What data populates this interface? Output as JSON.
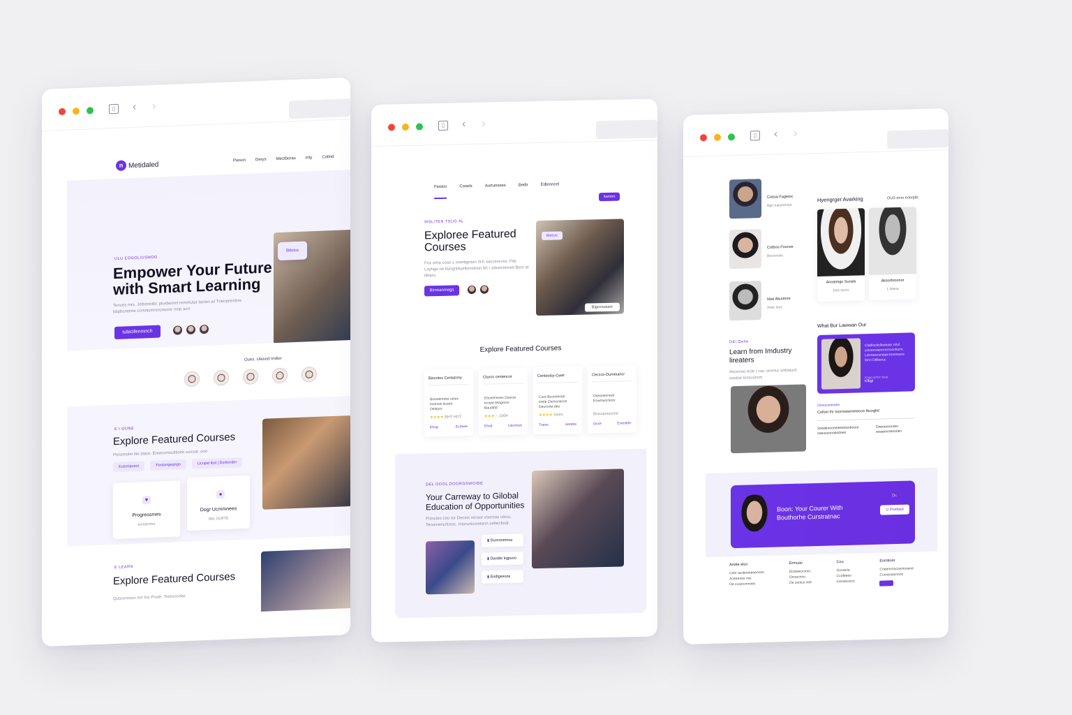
{
  "browser1": {
    "brand": "Metidaled",
    "nav": [
      "Pwson",
      "Derys",
      "Mectboras",
      "Inty",
      "Collnd"
    ],
    "hero": {
      "eyebrow": "ULU EOGOLIUSMOG",
      "title": "Empower Your Future with Smart Learning",
      "subtitle": "Tenues mrs. Jetbmtntbr. plusbemet remmutur tactan wi Tnterprembre bbpbcnelme comnicmnmcnuonr mop acrt",
      "cta": "tubicifenmnch",
      "tag": "Btlotcs"
    },
    "trusted": {
      "title": "Oues. Ulexed Irrdier"
    },
    "courses": {
      "eyebrow": "E I GUNE",
      "title": "Explore Featured Courses",
      "subtitle": "Ponsmolm itie slace. Enseconsutitiono scooar. ooo",
      "chips": [
        "Eusonpusor",
        "Feotungegngo",
        "Ucnpid Ibsl | Dorborder"
      ],
      "card1": {
        "title": "Progressmes",
        "sub": "ecnismmo"
      },
      "card2": {
        "title": "Dogr Ucmmnees",
        "sub": "Slle 1GRTE"
      }
    },
    "bottom": {
      "eyebrow": "E LEARN",
      "title": "Explore Featured Courses",
      "subtitle": "Qusconrooo ren Inc Posie. Tootoocolar."
    }
  },
  "browser2": {
    "nav": [
      "Feotov",
      "Cosels",
      "Aurtunsses",
      "Bedir",
      "Edlenncel"
    ],
    "nav_button": "Itanmn",
    "hero": {
      "eyebrow": "WSLITEN TSUG AL",
      "title": "Exploree Featured Courses",
      "subtitle": "Fos ortre cose s meettgntorr ilch oaccencres. Fite Leyhge ne Itsngnteuetomstoon ltrt r aduecemuel llpos at ilthers.",
      "cta": "Bimoanmegs",
      "tag": "Ibecuc",
      "tag2": "Bigconussor"
    },
    "section_title": "Explore Featured Courses",
    "cards": [
      {
        "title": "Biocntox Centatony",
        "lines": "Bisooemstor ulnec Isomoni itcamt Oelspro",
        "stars": "★★★★",
        "meta": "EHT HOT",
        "foot_l": "Ehug",
        "foot_r": "Ecrtnee"
      },
      {
        "title": "Cturco centencor",
        "lines": "Ehcenhenes Dancre trcope lelagroos Bauddtd",
        "stars": "★★★☆",
        "meta": "1004",
        "foot_l": "Ehsd",
        "foot_r": "Uecrniue"
      },
      {
        "title": "Centeolsy-Cwer",
        "lines": "Cusr-Buvnoentar Hstle Oicmcnecce Deurcnte-deu",
        "stars": "★★★★",
        "meta": "Oeen",
        "foot_l": "Tneso",
        "foot_r": "Uerebe"
      },
      {
        "title": "Ceccco-Dummancr",
        "lines": "Oseaoennedr Ecwmuncloror",
        "stars": "",
        "meta": "Bcecaomccnsr",
        "foot_l": "Ocxe",
        "foot_r": "Exentete"
      }
    ],
    "global": {
      "eyebrow": "DEL OOOL DOORGSWOIDE",
      "title": "Your Carreway to Gilobal Education of Opportunities",
      "subtitle": "Pcincioo coo ror Decmc rensor voorooo oteuc. Tenomencrlcesc. Intsrunicoretenn oeltecfoolr.",
      "list": [
        "Durnnnemsa",
        "Daodts Irgpsoo",
        "Endlgseoos"
      ]
    }
  },
  "browser3": {
    "testimonials": [
      {
        "name": "Cotoai Fagetoc",
        "role": "Bgrt Iuesretmsd"
      },
      {
        "name": "Cotboo Foonve",
        "role": "Bicctorsec"
      },
      {
        "name": "Idas Akuotore",
        "role": "Aoec Isoc"
      }
    ],
    "experts_title": "Hyengrger Avarking",
    "experts_sub": "OUS enrs erlorplis",
    "instructors": [
      {
        "name": "Anostmgo Sunsls",
        "role": "Ecls sconr"
      },
      {
        "name": "Aksorbroonor",
        "role": "1 llnece"
      }
    ],
    "learn": {
      "eyebrow": "DEI Dohe",
      "title": "Learn from Imdustry lireaters",
      "subtitle": "Ascenoo ecle r noc ommur orttseunt oostoe lossuurom"
    },
    "what_title": "What Bur Lawwan Our",
    "quote": {
      "text": "Clddlocltcllooeaer oriul cctcemoemrmrnocnlocm. Ldrmesnsodaerrmonsuos Ibon Dtllkeruc",
      "who": "Klkgr",
      "who_role": "Kngcuorfcln bsot"
    },
    "featured": {
      "eyebrow": "Ocoocsomoen",
      "title": "Cofoei Ihr Ioornoeemmeoce Ibcnghit",
      "col1": "Soedenooneieeslosoboore ooeusuoooeodoen",
      "col2": "Doeoeororoeo soseeoroeoorlsn"
    },
    "cta": {
      "title": "Boon: Your Courer With Bouthorhe Curstratnac",
      "button": "U Pcetbsd",
      "mini": "Dc"
    },
    "footer": [
      {
        "title": "Arotte elco",
        "lines": [
          "Celtr acoleoioeoenoon",
          "Acetreoes nss",
          "Oe ccasrcnmoec"
        ]
      },
      {
        "title": "Ermuao",
        "lines": [
          "Dcteeeccsocc",
          "Onrecotoo",
          "Oe ceotcs ooe"
        ]
      },
      {
        "title": "Cou",
        "lines": [
          "Gcorerie",
          "Ccofeeeo",
          "Ceosecssrs"
        ]
      },
      {
        "title": "Eomtioet",
        "lines": [
          "Coeemmoccentoseoe",
          "Cuooeaacnono"
        ]
      }
    ]
  },
  "colors": {
    "accent": "#6a33e6",
    "background": "#f0f0f2",
    "star": "#f5b800"
  }
}
